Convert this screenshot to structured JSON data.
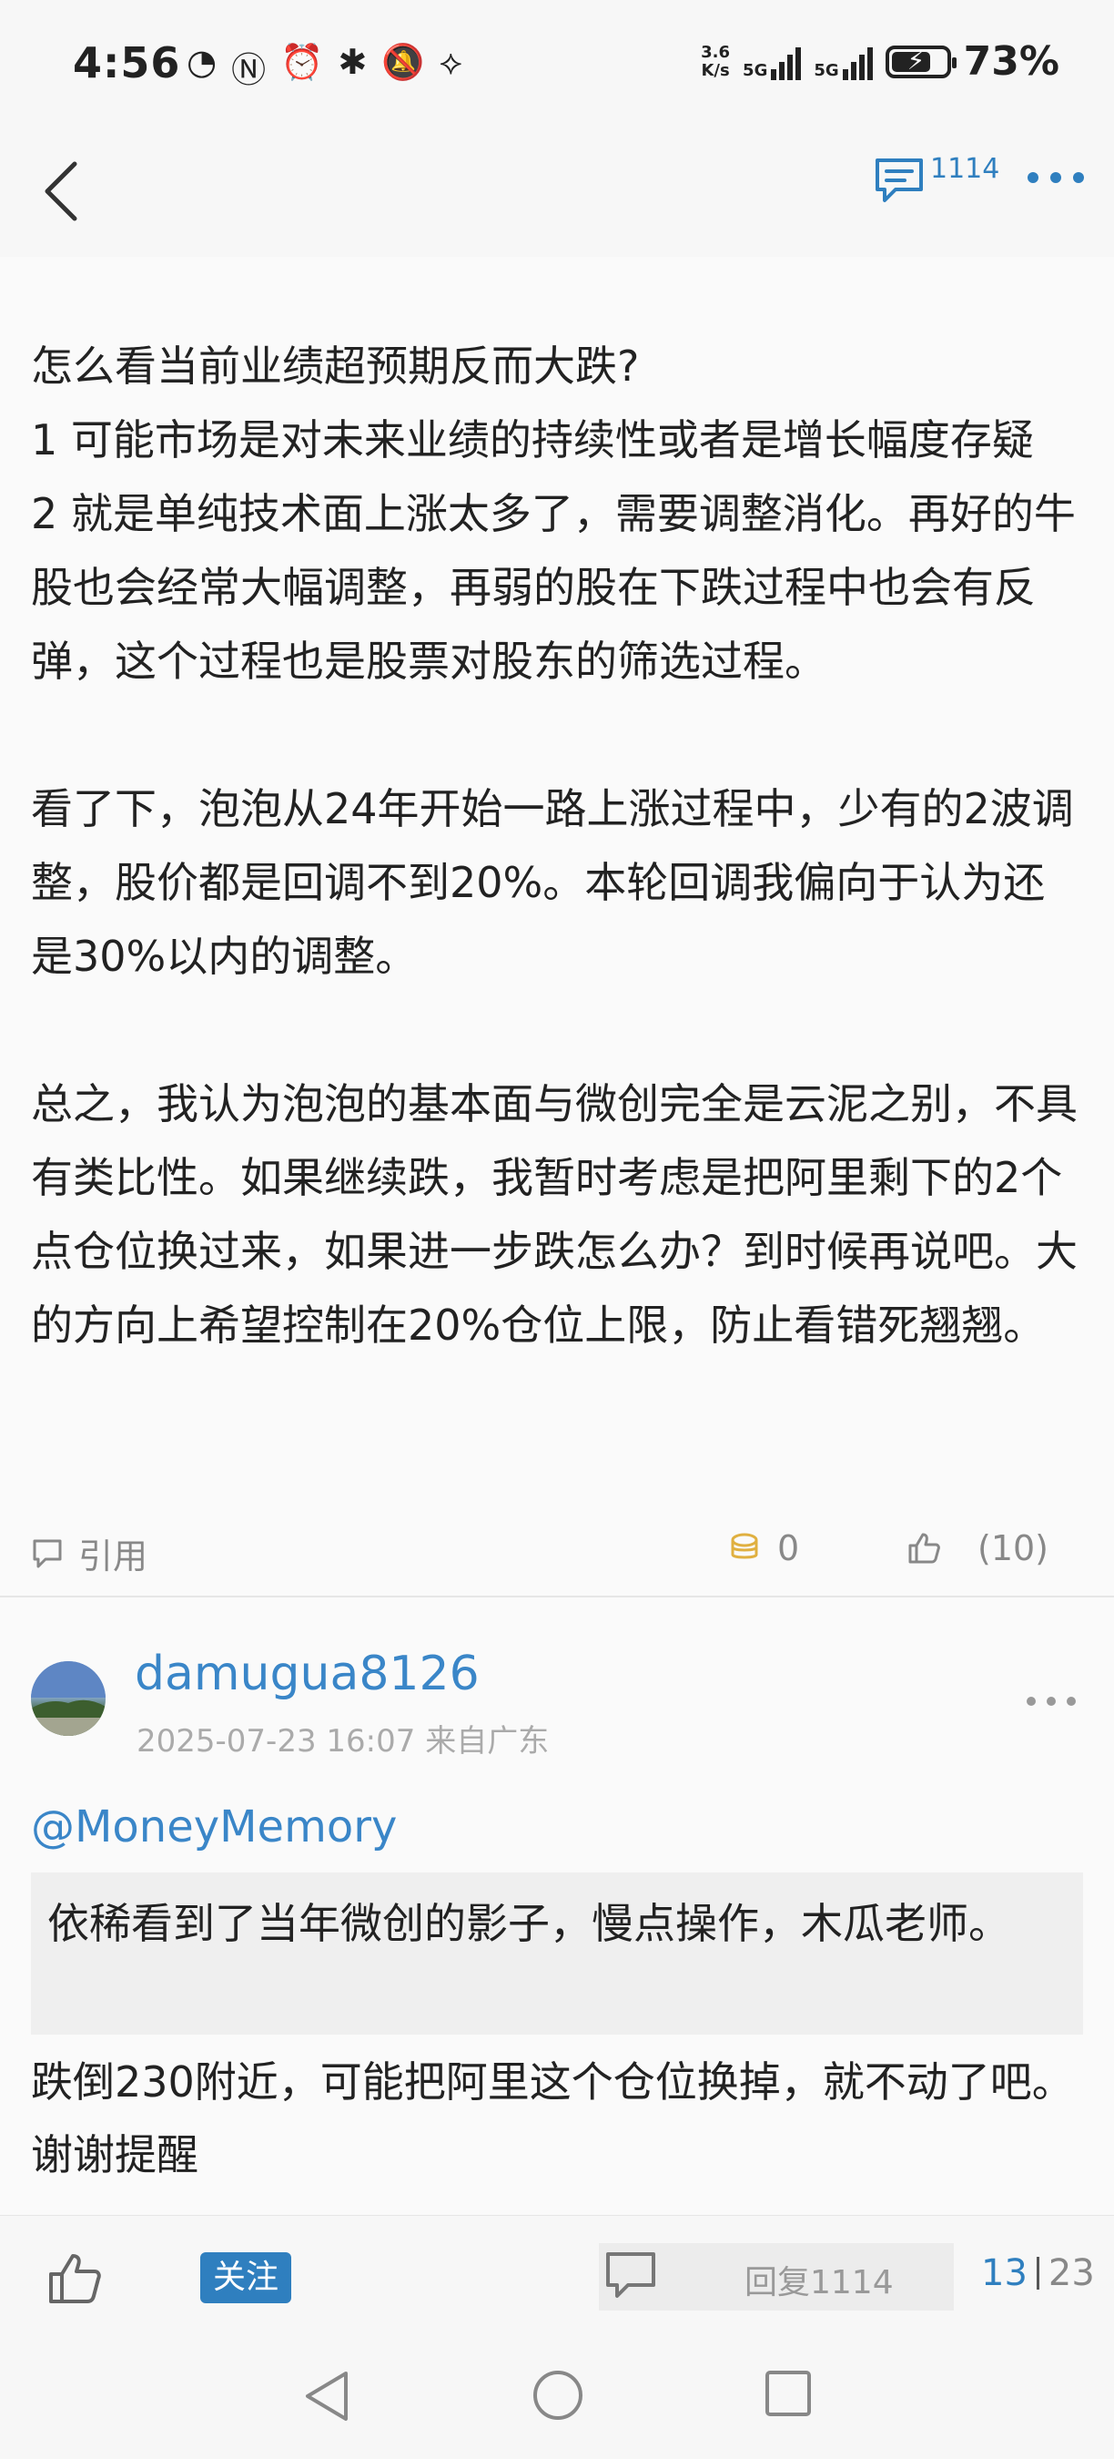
{
  "status_bar": {
    "time": "4:56",
    "net_speed_value": "3.6",
    "net_speed_unit": "K/s",
    "signal1_label": "5G",
    "signal2_label": "5G",
    "battery_pct": "73%",
    "battery_level": 0.73
  },
  "header": {
    "comment_count": "1114"
  },
  "post": {
    "paragraphs": [
      "怎么看当前业绩超预期反而大跌?\n1 可能市场是对未来业绩的持续性或者是增长幅度存疑\n2 就是单纯技术面上涨太多了，需要调整消化。再好的牛股也会经常大幅调整，再弱的股在下跌过程中也会有反弹，这个过程也是股票对股东的筛选过程。",
      "看了下，泡泡从24年开始一路上涨过程中，少有的2波调整，股价都是回调不到20%。本轮回调我偏向于认为还是30%以内的调整。",
      "总之，我认为泡泡的基本面与微创完全是云泥之别，不具有类比性。如果继续跌，我暂时考虑是把阿里剩下的2个点仓位换过来，如果进一步跌怎么办？到时候再说吧。大的方向上希望控制在20%仓位上限，防止看错死翘翘。"
    ],
    "quote_label": "引用",
    "coin_count": "0",
    "like_count": "(10)"
  },
  "reply": {
    "username": "damugua8126",
    "timestamp": "2025-07-23 16:07",
    "location": "来自广东",
    "mention": "@MoneyMemory",
    "quoted_text": "依稀看到了当年微创的影子，慢点操作，木瓜老师。",
    "text": "跌倒230附近，可能把阿里这个仓位换掉，就不动了吧。谢谢提醒"
  },
  "bottom_bar": {
    "follow_label": "关注",
    "reply_label": "回复1114",
    "page_current": "13",
    "page_total": "23"
  }
}
